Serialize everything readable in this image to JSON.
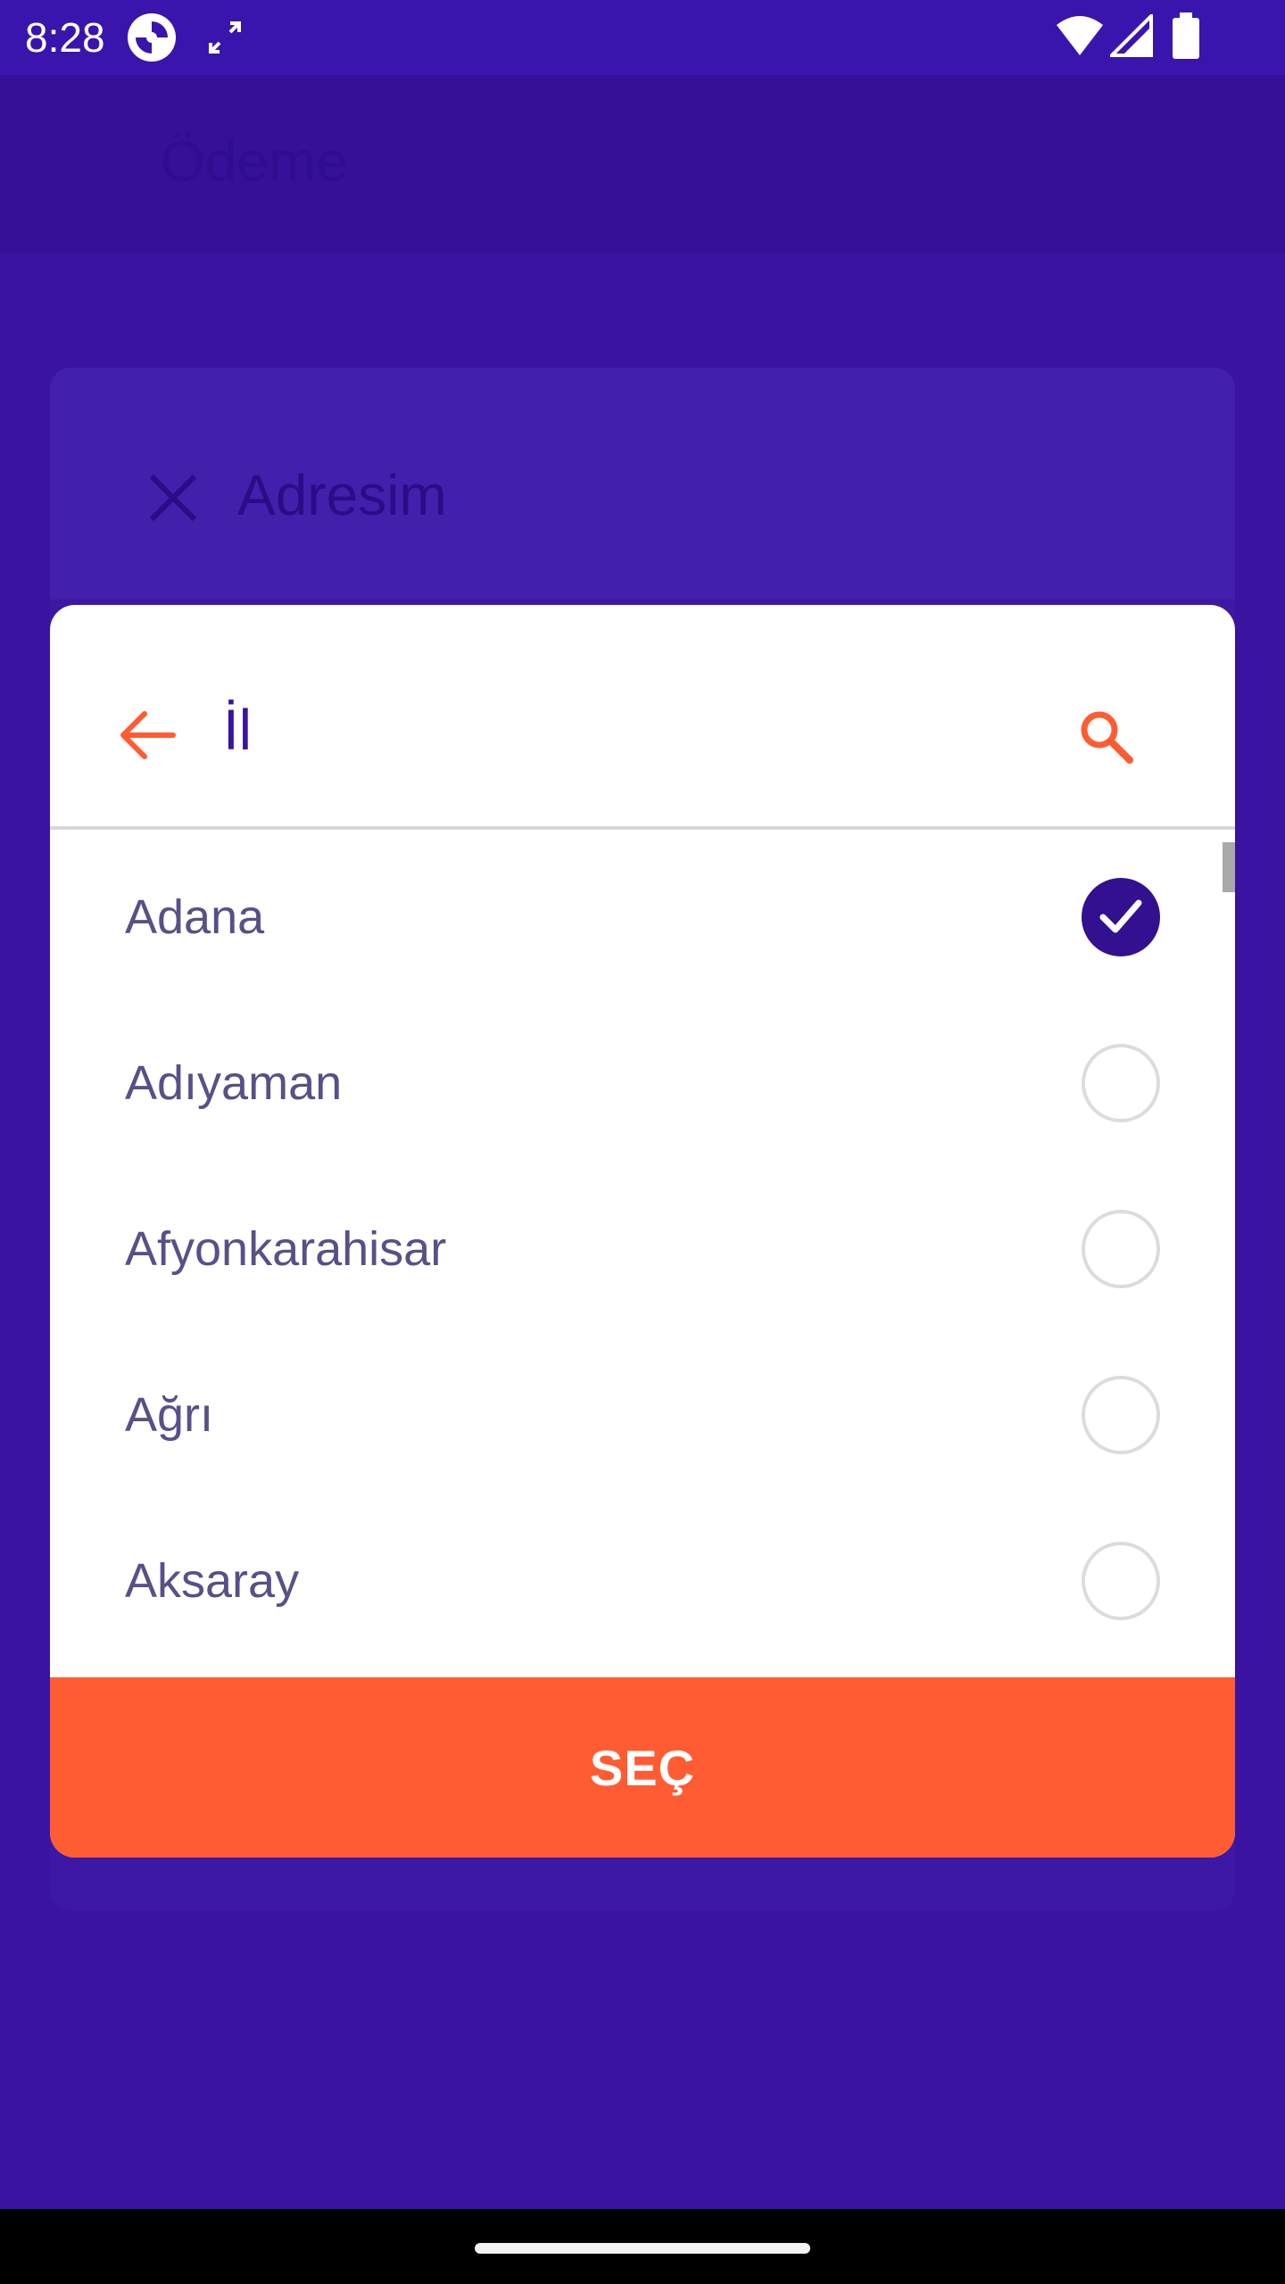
{
  "status_bar": {
    "time": "8:28",
    "icons": [
      "app-icon",
      "screen-rotate-icon",
      "wifi-icon",
      "signal-icon",
      "battery-icon"
    ]
  },
  "background": {
    "app_bar_title": "Ödeme",
    "card_title": "Adresim"
  },
  "dialog": {
    "title": "İl",
    "items": [
      {
        "label": "Adana",
        "selected": true
      },
      {
        "label": "Adıyaman",
        "selected": false
      },
      {
        "label": "Afyonkarahisar",
        "selected": false
      },
      {
        "label": "Ağrı",
        "selected": false
      },
      {
        "label": "Aksaray",
        "selected": false
      }
    ],
    "select_button": "SEÇ"
  },
  "colors": {
    "primary": "#3a13a0",
    "accent": "#ff5c33",
    "checked": "#33108f"
  }
}
